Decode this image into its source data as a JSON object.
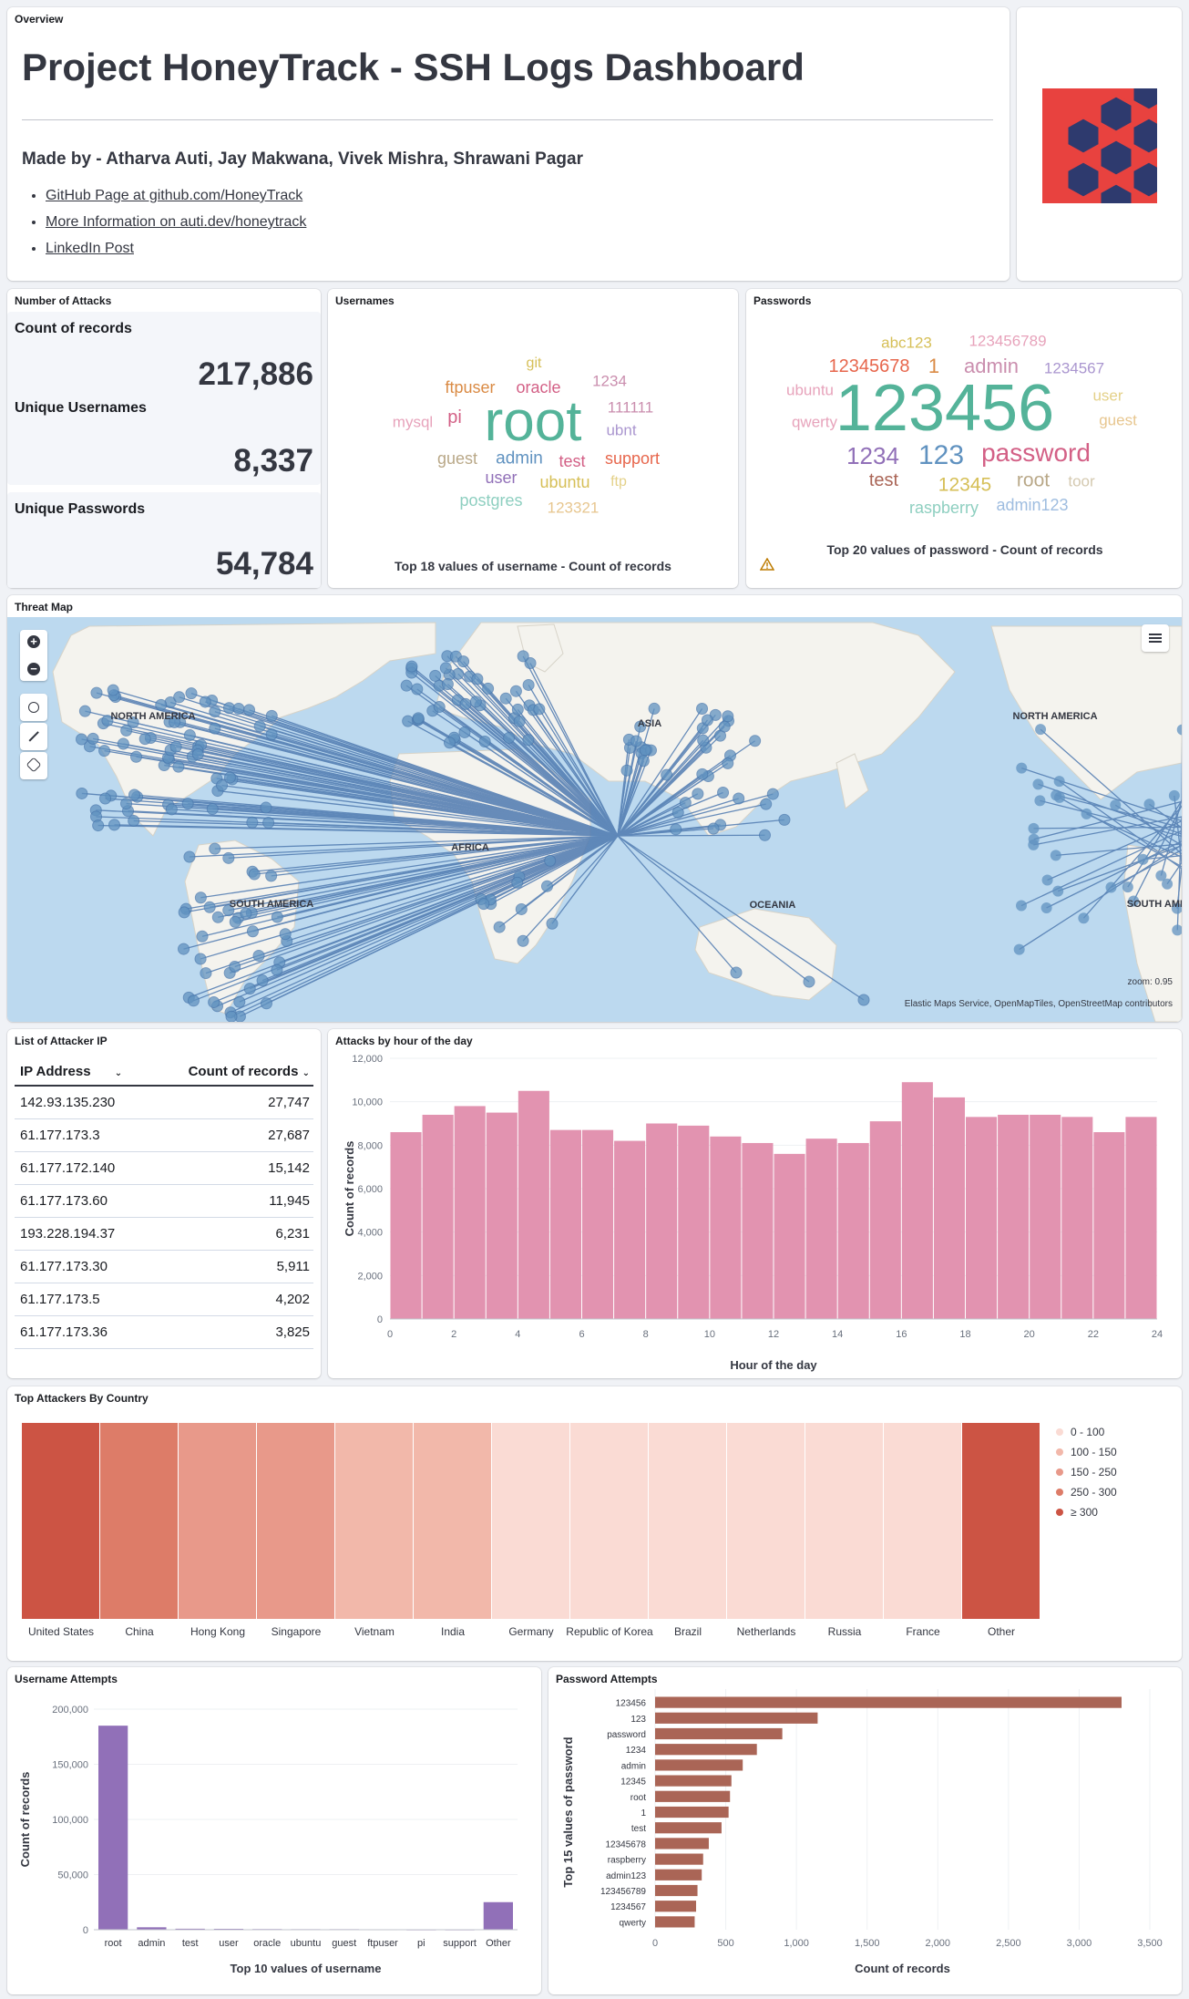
{
  "overview": {
    "panel_title": "Overview",
    "title": "Project HoneyTrack - SSH Logs Dashboard",
    "made_by": "Made by - Atharva Auti, Jay Makwana, Vivek Mishra, Shrawani Pagar",
    "links": [
      "GitHub Page at github.com/HoneyTrack",
      "More Information on auti.dev/honeytrack",
      "LinkedIn Post"
    ]
  },
  "attacks": {
    "panel_title": "Number of Attacks",
    "metrics": [
      {
        "label": "Count of records",
        "value": "217,886"
      },
      {
        "label": "Unique Usernames",
        "value": "8,337"
      },
      {
        "label": "Unique Passwords",
        "value": "54,784"
      }
    ]
  },
  "usernames": {
    "panel_title": "Usernames",
    "caption": "Top 18 values of username - Count of records",
    "words": [
      "root",
      "pi",
      "ftpuser",
      "oracle",
      "git",
      "1234",
      "111111",
      "ubnt",
      "mysql",
      "guest",
      "admin",
      "test",
      "support",
      "user",
      "ubuntu",
      "ftp",
      "postgres",
      "123321"
    ]
  },
  "passwords": {
    "panel_title": "Passwords",
    "caption": "Top 20 values of password - Count of records",
    "warning_icon": "warning-icon",
    "words": [
      "123456",
      "password",
      "123",
      "1234",
      "12345678",
      "1",
      "admin",
      "abc123",
      "123456789",
      "1234567",
      "ubuntu",
      "qwerty",
      "user",
      "guest",
      "test",
      "12345",
      "root",
      "toor",
      "raspberry",
      "admin123"
    ]
  },
  "map": {
    "panel_title": "Threat Map",
    "labels": [
      "NORTH AMERICA",
      "ASIA",
      "AFRICA",
      "SOUTH AMERICA",
      "OCEANIA",
      "NORTH AMERICA",
      "SOUTH AMERICA"
    ],
    "zoom": "zoom: 0.95",
    "attribution": "Elastic Maps Service, OpenMapTiles, OpenStreetMap contributors",
    "controls": [
      "zoom-in-icon",
      "zoom-out-icon",
      "locate-icon",
      "fullscreen-icon",
      "tools-icon",
      "legend-toggle-icon"
    ]
  },
  "ip_list": {
    "panel_title": "List of Attacker IP",
    "headers": [
      "IP Address",
      "Count of records"
    ],
    "rows": [
      [
        "142.93.135.230",
        "27,747"
      ],
      [
        "61.177.173.3",
        "27,687"
      ],
      [
        "61.177.172.140",
        "15,142"
      ],
      [
        "61.177.173.60",
        "11,945"
      ],
      [
        "193.228.194.37",
        "6,231"
      ],
      [
        "61.177.173.30",
        "5,911"
      ],
      [
        "61.177.173.5",
        "4,202"
      ],
      [
        "61.177.173.36",
        "3,825"
      ]
    ]
  },
  "hourly": {
    "panel_title": "Attacks by hour of the day",
    "xlabel": "Hour of the day",
    "ylabel": "Count of records",
    "color": "#e293b0"
  },
  "country": {
    "panel_title": "Top Attackers By Country",
    "legend": [
      "0 - 100",
      "100 - 150",
      "150 - 250",
      "250 - 300",
      "≥ 300"
    ],
    "legend_colors": [
      "#fadbd4",
      "#f2b8aa",
      "#e8998a",
      "#dd7c68",
      "#cc5444"
    ]
  },
  "uname_attempts": {
    "panel_title": "Username Attempts",
    "xlabel": "Top 10 values of username",
    "ylabel": "Count of records",
    "color": "#9170b8"
  },
  "pw_attempts": {
    "panel_title": "Password Attempts",
    "xlabel": "Count of records",
    "ylabel": "Top 15 values of password",
    "color": "#aa6556"
  },
  "chart_data": [
    {
      "type": "bar",
      "x": [
        0,
        1,
        2,
        3,
        4,
        5,
        6,
        7,
        8,
        9,
        10,
        11,
        12,
        13,
        14,
        15,
        16,
        17,
        18,
        19,
        20,
        21,
        22,
        23
      ],
      "values": [
        8600,
        9400,
        9800,
        9500,
        10500,
        8700,
        8700,
        8200,
        9000,
        8900,
        8400,
        8100,
        7600,
        8300,
        8100,
        9100,
        10900,
        10200,
        9300,
        9400,
        9400,
        9300,
        8600,
        9300
      ],
      "xlabel": "Hour of the day",
      "ylabel": "Count of records",
      "ylim": [
        0,
        12000
      ],
      "xticks": [
        0,
        2,
        4,
        6,
        8,
        10,
        12,
        14,
        16,
        18,
        20,
        22,
        24
      ],
      "yticks": [
        "0",
        "2,000",
        "4,000",
        "6,000",
        "8,000",
        "10,000",
        "12,000"
      ]
    },
    {
      "type": "heatmap",
      "categories": [
        "United States",
        "China",
        "Hong Kong",
        "Singapore",
        "Vietnam",
        "India",
        "Germany",
        "Republic of Korea",
        "Brazil",
        "Netherlands",
        "Russia",
        "France",
        "Other"
      ],
      "bins": [
        "≥ 300",
        "250 - 300",
        "150 - 250",
        "150 - 250",
        "100 - 150",
        "100 - 150",
        "0 - 100",
        "0 - 100",
        "0 - 100",
        "0 - 100",
        "0 - 100",
        "0 - 100",
        "≥ 300"
      ]
    },
    {
      "type": "bar",
      "categories": [
        "root",
        "admin",
        "test",
        "user",
        "oracle",
        "ubuntu",
        "guest",
        "ftpuser",
        "pi",
        "support",
        "Other"
      ],
      "values": [
        185000,
        2200,
        900,
        800,
        600,
        500,
        500,
        400,
        300,
        300,
        25000
      ],
      "xlabel": "Top 10 values of username",
      "ylabel": "Count of records",
      "ylim": [
        0,
        200000
      ],
      "yticks": [
        "0",
        "50,000",
        "100,000",
        "150,000",
        "200,000"
      ]
    },
    {
      "type": "bar",
      "orientation": "horizontal",
      "categories": [
        "123456",
        "123",
        "password",
        "1234",
        "admin",
        "12345",
        "root",
        "1",
        "test",
        "12345678",
        "raspberry",
        "admin123",
        "123456789",
        "1234567",
        "qwerty"
      ],
      "values": [
        3300,
        1150,
        900,
        720,
        620,
        540,
        530,
        520,
        470,
        380,
        340,
        330,
        300,
        290,
        280
      ],
      "xlabel": "Count of records",
      "ylabel": "Top 15 values of password",
      "xlim": [
        0,
        3500
      ],
      "xticks": [
        "0",
        "500",
        "1,000",
        "1,500",
        "2,000",
        "2,500",
        "3,000",
        "3,500"
      ]
    }
  ]
}
